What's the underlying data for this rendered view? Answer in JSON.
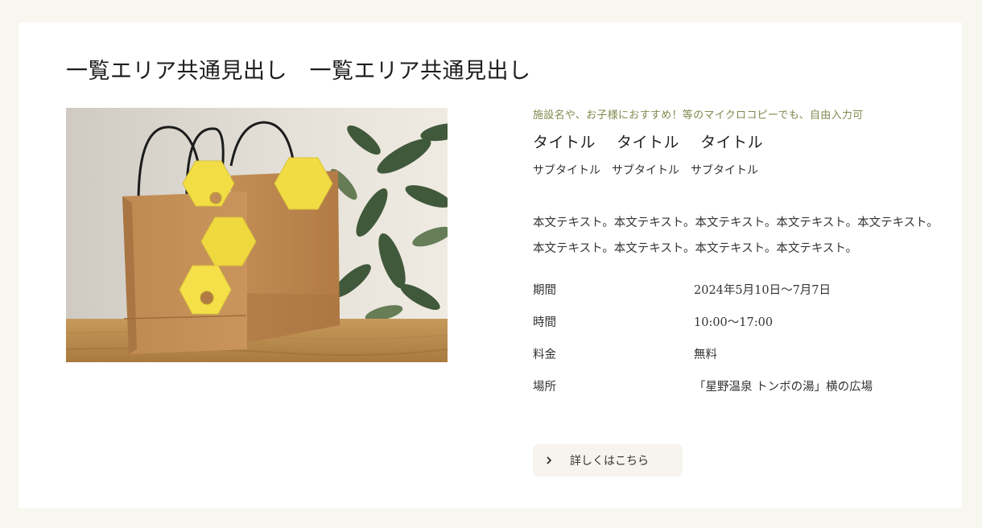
{
  "section": {
    "heading": "一覧エリア共通見出し　一覧エリア共通見出し"
  },
  "item": {
    "image_alt": "クラフト紙のショッピングバッグと黄色い六角形のタグ",
    "micro_copy": "施設名や、お子様におすすめ！等のマイクロコピーでも、自由入力可",
    "title": "タイトル　 タイトル　 タイトル",
    "subtitle": "サブタイトル　サブタイトル　サブタイトル",
    "body": [
      "本文テキスト。本文テキスト。本文テキスト。本文テキスト。本文テキスト。",
      "本文テキスト。本文テキスト。本文テキスト。本文テキスト。"
    ],
    "details": [
      {
        "label": "期間",
        "value": "2024年5月10日〜7月7日"
      },
      {
        "label": "時間",
        "value": "10:00〜17:00"
      },
      {
        "label": "料金",
        "value": "無料"
      },
      {
        "label": "場所",
        "value": "「星野温泉 トンボの湯」横の広場"
      }
    ],
    "button_label": "詳しくはこちら",
    "button_icon": "chevron-right-icon"
  },
  "colors": {
    "page_background": "#f7f6ef",
    "card_background": "#ffffff",
    "micro_copy": "#7f8a4f",
    "button_background": "#f6f4ec"
  }
}
